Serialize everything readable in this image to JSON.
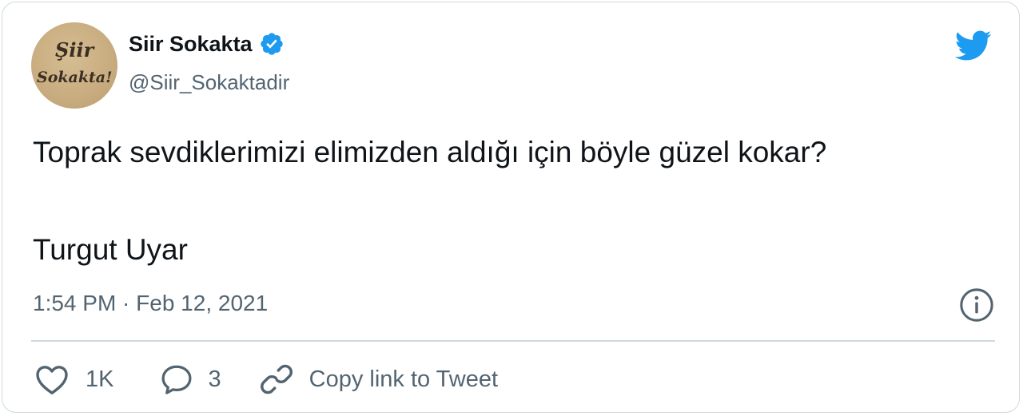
{
  "account": {
    "avatar_line1": "Şiir",
    "avatar_line2": "Sokakta!",
    "name": "Siir Sokakta",
    "verified_icon": "verified-badge-icon",
    "handle": "@Siir_Sokaktadir"
  },
  "logo_icon": "twitter-bird-icon",
  "tweet": {
    "text_line1": "Toprak sevdiklerimizi elimizden aldığı için böyle güzel kokar?",
    "text_line2": "Turgut Uyar",
    "timestamp": "1:54 PM · Feb 12, 2021"
  },
  "actions": {
    "like_icon": "heart-icon",
    "like_count": "1K",
    "reply_icon": "reply-bubble-icon",
    "reply_count": "3",
    "copy_icon": "link-icon",
    "copy_label": "Copy link to Tweet",
    "info_icon": "info-icon"
  },
  "colors": {
    "text": "#0f1419",
    "secondary": "#536471",
    "twitter_blue": "#1d9bf0",
    "border": "#cfd9de"
  }
}
